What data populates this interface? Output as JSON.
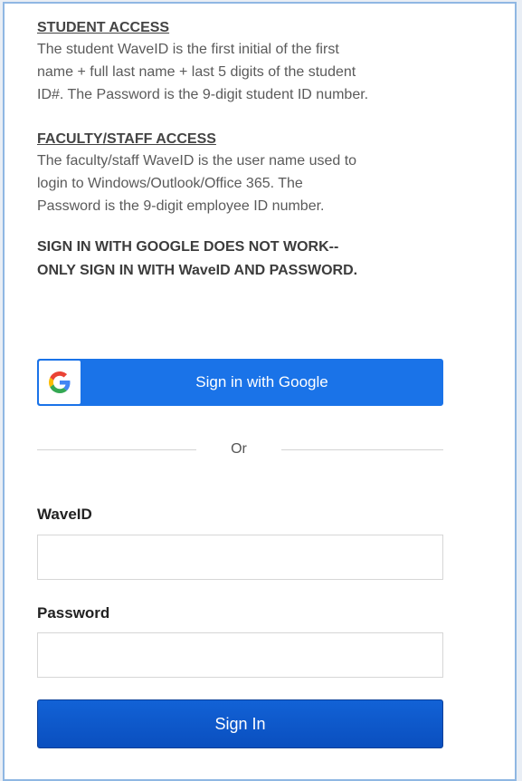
{
  "student_access": {
    "heading": "STUDENT ACCESS",
    "lines": [
      "The student WaveID is the first initial of the first",
      "name + full last name + last 5 digits of the student",
      "ID#. The Password is the 9-digit student ID number."
    ]
  },
  "faculty_access": {
    "heading": "FACULTY/STAFF ACCESS",
    "lines": [
      "The faculty/staff WaveID is the user name used to",
      "login to Windows/Outlook/Office 365. The",
      "Password is the 9-digit employee ID number."
    ]
  },
  "notice": {
    "lines": [
      "SIGN IN WITH GOOGLE DOES NOT WORK--",
      "ONLY SIGN IN WITH WaveID AND PASSWORD."
    ]
  },
  "google_button": {
    "label": "Sign in with Google",
    "icon": "google-g-icon"
  },
  "divider": {
    "label": "Or"
  },
  "waveid_field": {
    "label": "WaveID",
    "value": "",
    "placeholder": ""
  },
  "password_field": {
    "label": "Password",
    "value": "",
    "placeholder": ""
  },
  "signin_button": {
    "label": "Sign In"
  },
  "colors": {
    "google_blue": "#1a73e8",
    "signin_blue": "#0b57d0",
    "frame_border": "#8fb7e3"
  }
}
